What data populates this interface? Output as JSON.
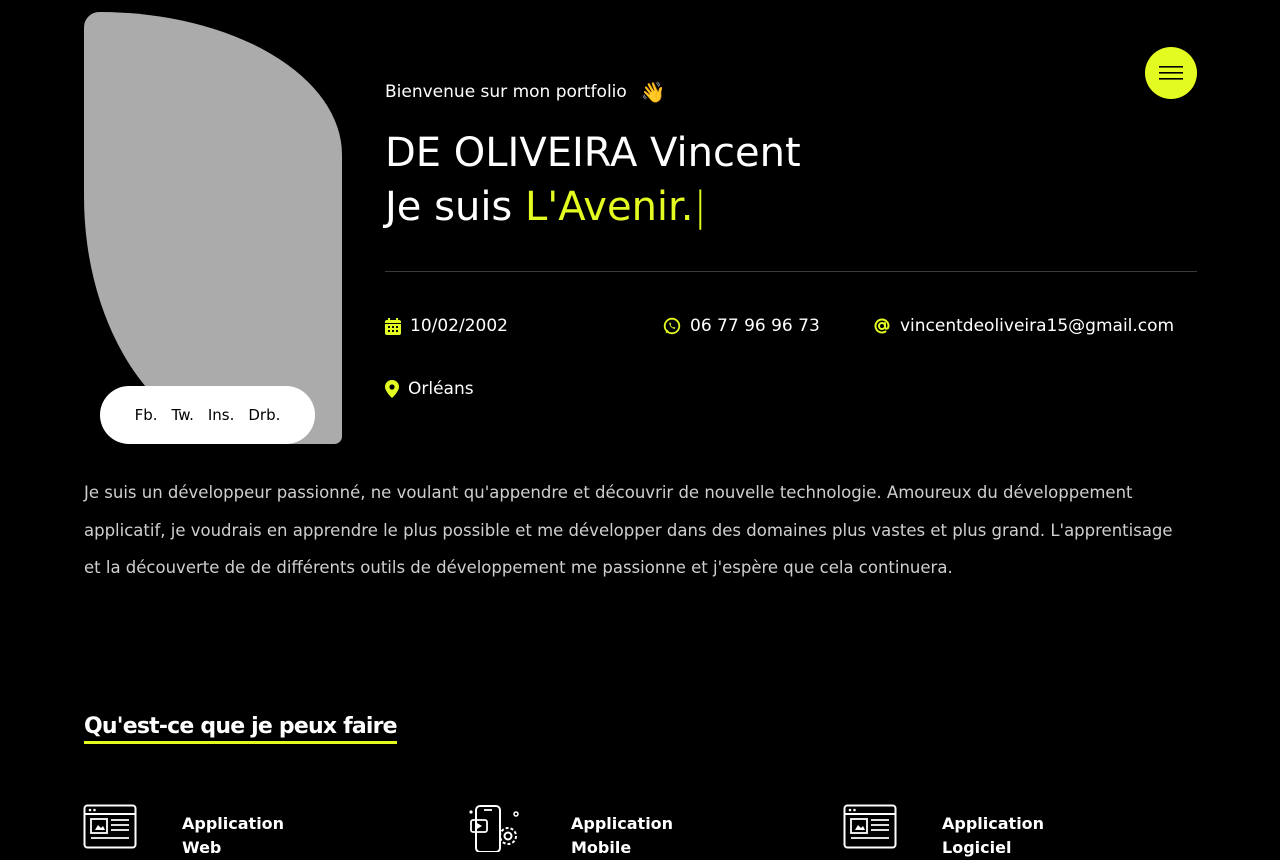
{
  "header": {
    "welcome": "Bienvenue sur mon portfolio",
    "wave_emoji": "👋",
    "name": "DE OLIVEIRA Vincent",
    "tagline_prefix": "Je suis",
    "tagline_highlight": "L'Avenir.",
    "cursor": "|"
  },
  "socials": [
    "Fb.",
    "Tw.",
    "Ins.",
    "Drb."
  ],
  "contact": {
    "birthdate": "10/02/2002",
    "phone": "06 77 96 96 73",
    "email": "vincentdeoliveira15@gmail.com",
    "city": "Orléans"
  },
  "about": "Je suis un développeur passionné, ne voulant qu'appendre et découvrir de nouvelle technologie. Amoureux du développement applicatif, je voudrais en apprendre le plus possible et me développer dans des domaines plus vastes et plus grand. L'apprentisage et la découverte de de différents outils de développement me passionne et j'espère que cela continuera.",
  "services_title": "Qu'est-ce que je peux faire",
  "services": [
    {
      "line1": "Application",
      "line2": "Web",
      "icon": "web-app-icon"
    },
    {
      "line1": "Application",
      "line2": "Mobile",
      "icon": "mobile-app-icon"
    },
    {
      "line1": "Application",
      "line2": "Logiciel",
      "icon": "software-app-icon"
    }
  ],
  "icons": {
    "menu": "hamburger-icon",
    "birthdate": "calendar-icon",
    "phone": "whatsapp-icon",
    "email": "at-icon",
    "city": "map-pin-icon"
  },
  "colors": {
    "accent": "#e4fb22",
    "background": "#000000",
    "photo_placeholder": "#ababab",
    "text_muted": "#cfcfcf"
  }
}
